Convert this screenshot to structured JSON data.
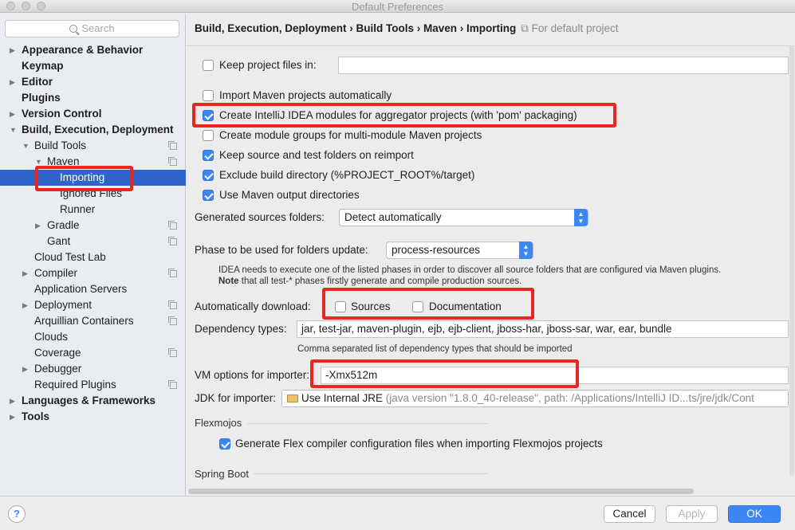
{
  "window": {
    "title": "Default Preferences"
  },
  "sidebar": {
    "search_placeholder": "Search",
    "items": [
      {
        "label": "Appearance & Behavior"
      },
      {
        "label": "Keymap"
      },
      {
        "label": "Editor"
      },
      {
        "label": "Plugins"
      },
      {
        "label": "Version Control"
      },
      {
        "label": "Build, Execution, Deployment"
      },
      {
        "label": "Build Tools"
      },
      {
        "label": "Maven"
      },
      {
        "label": "Importing"
      },
      {
        "label": "Ignored Files"
      },
      {
        "label": "Runner"
      },
      {
        "label": "Gradle"
      },
      {
        "label": "Gant"
      },
      {
        "label": "Cloud Test Lab"
      },
      {
        "label": "Compiler"
      },
      {
        "label": "Application Servers"
      },
      {
        "label": "Deployment"
      },
      {
        "label": "Arquillian Containers"
      },
      {
        "label": "Clouds"
      },
      {
        "label": "Coverage"
      },
      {
        "label": "Debugger"
      },
      {
        "label": "Required Plugins"
      },
      {
        "label": "Languages & Frameworks"
      },
      {
        "label": "Tools"
      }
    ]
  },
  "header": {
    "breadcrumb": "Build, Execution, Deployment › Build Tools › Maven › Importing",
    "note": "For default project"
  },
  "settings": {
    "keep_project_files": {
      "label": "Keep project files in:",
      "checked": false,
      "value": ""
    },
    "import_auto": {
      "label": "Import Maven projects automatically",
      "checked": false
    },
    "create_modules": {
      "label": "Create IntelliJ IDEA modules for aggregator projects (with 'pom' packaging)",
      "checked": true
    },
    "create_groups": {
      "label": "Create module groups for multi-module Maven projects",
      "checked": false
    },
    "keep_source": {
      "label": "Keep source and test folders on reimport",
      "checked": true
    },
    "exclude_build": {
      "label": "Exclude build directory (%PROJECT_ROOT%/target)",
      "checked": true
    },
    "use_output": {
      "label": "Use Maven output directories",
      "checked": true
    },
    "generated_sources": {
      "label": "Generated sources folders:",
      "value": "Detect automatically"
    },
    "phase": {
      "label": "Phase to be used for folders update:",
      "value": "process-resources"
    },
    "phase_help_1": "IDEA needs to execute one of the listed phases in order to discover all source folders that are configured via Maven plugins.",
    "phase_help_2_bold": "Note",
    "phase_help_2": " that all test-* phases firstly generate and compile production sources.",
    "auto_download": {
      "label": "Automatically download:",
      "sources": {
        "label": "Sources",
        "checked": false
      },
      "documentation": {
        "label": "Documentation",
        "checked": false
      }
    },
    "dependency_types": {
      "label": "Dependency types:",
      "value": "jar, test-jar, maven-plugin, ejb, ejb-client, jboss-har, jboss-sar, war, ear, bundle",
      "help": "Comma separated list of dependency types that should be imported"
    },
    "vm_options": {
      "label": "VM options for importer:",
      "value": "-Xmx512m"
    },
    "jdk": {
      "label": "JDK for importer:",
      "value": "Use Internal JRE",
      "detail": " (java version \"1.8.0_40-release\", path: /Applications/IntelliJ ID...ts/jre/jdk/Cont"
    },
    "flexmojos": {
      "title": "Flexmojos",
      "generate": {
        "label": "Generate Flex compiler configuration files when importing Flexmojos projects",
        "checked": true
      }
    },
    "spring_boot": {
      "title": "Spring Boot"
    }
  },
  "footer": {
    "help_label": "?",
    "cancel": "Cancel",
    "apply": "Apply",
    "ok": "OK"
  },
  "colors": {
    "accent": "#3d86f5",
    "selection": "#2f65ca",
    "highlight": "#e8271e"
  }
}
